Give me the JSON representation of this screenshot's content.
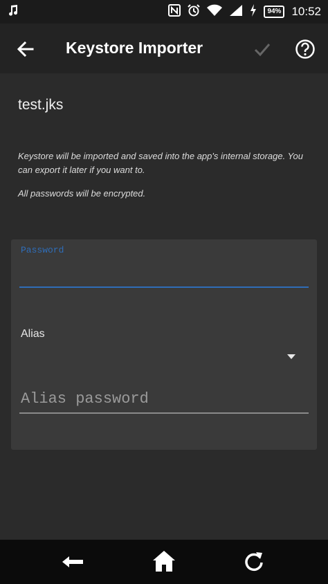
{
  "status_bar": {
    "battery": "94%",
    "time": "10:52"
  },
  "app_bar": {
    "title": "Keystore Importer"
  },
  "file": {
    "name": "test.jks"
  },
  "info": {
    "line1": "Keystore will be imported and saved into the app's internal storage. You can export it later if you want to.",
    "line2": "All passwords will be encrypted."
  },
  "form": {
    "password_label": "Password",
    "alias_label": "Alias",
    "alias_value": "",
    "alias_password_placeholder": "Alias password"
  },
  "colors": {
    "accent": "#2f6db8",
    "background": "#2b2b2b",
    "card": "#3a3a3a"
  },
  "icons": {
    "music": "music-note-icon",
    "nfc": "nfc-icon",
    "alarm": "alarm-icon",
    "wifi": "wifi-icon",
    "signal": "signal-icon",
    "charging": "charging-icon",
    "back": "arrow-back-icon",
    "check": "check-icon",
    "help": "help-circle-icon",
    "dropdown": "dropdown-arrow-icon",
    "nav_back": "nav-back-icon",
    "nav_home": "home-icon",
    "nav_recent": "refresh-icon"
  }
}
